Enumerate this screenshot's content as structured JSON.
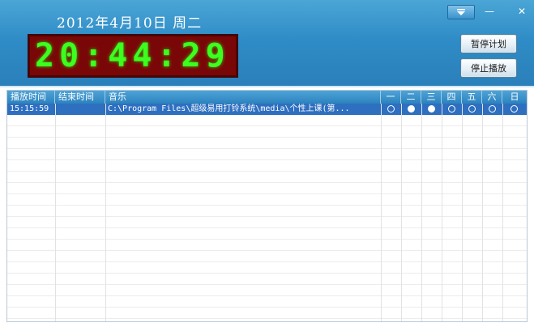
{
  "header": {
    "date": "2012年4月10日  周二",
    "clock": "20:44:29",
    "pause_label": "暂停计划",
    "stop_label": "停止播放",
    "min_glyph": "—",
    "close_glyph": "✕"
  },
  "table": {
    "columns": [
      "播放时间",
      "结束时间",
      "音乐",
      "一",
      "二",
      "三",
      "四",
      "五",
      "六",
      "日"
    ],
    "rows": [
      {
        "start": "15:15:59",
        "end": "",
        "music": "C:\\Program Files\\超级易用打铃系统\\media\\个性上课(第...",
        "days": [
          false,
          true,
          true,
          false,
          false,
          false,
          false
        ]
      }
    ]
  },
  "colors": {
    "header_blue": "#2f8cc6",
    "clock_bg": "#7a0707",
    "clock_digits": "#3cff1f",
    "selection": "#2e6fc0"
  }
}
